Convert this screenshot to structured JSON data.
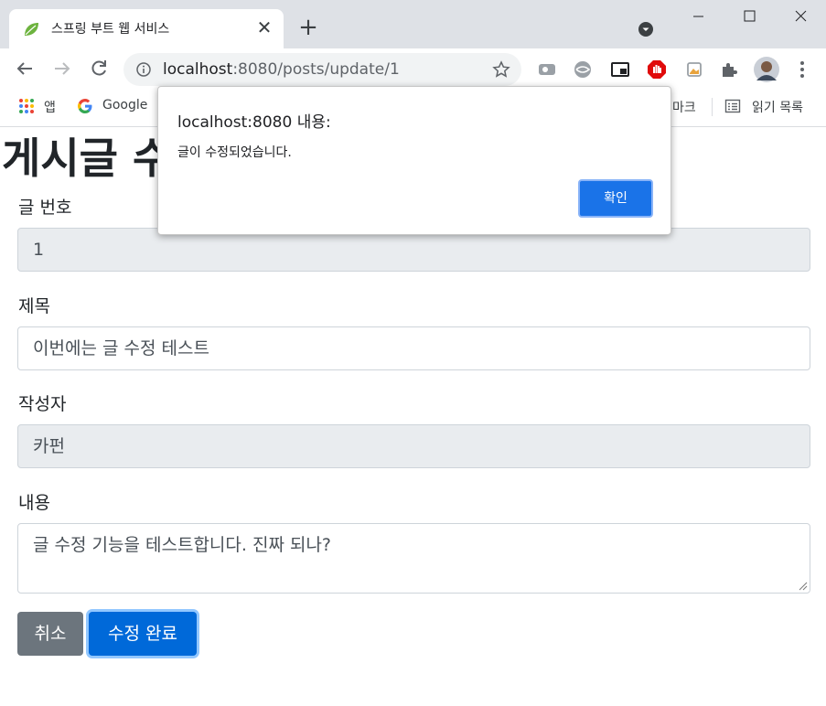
{
  "browser": {
    "tab_title": "스프링 부트 웹 서비스",
    "url_host": "localhost",
    "url_rest": ":8080/posts/update/1",
    "bookmarks": {
      "apps_label": "앱",
      "google_label": "Google",
      "bookmarks_label": "마크",
      "reading_list_label": "읽기 목록"
    }
  },
  "page": {
    "title": "게시글 수정",
    "fields": {
      "id_label": "글 번호",
      "id_value": "1",
      "title_label": "제목",
      "title_value": "이번에는 글 수정 테스트",
      "author_label": "작성자",
      "author_value": "카펀",
      "content_label": "내용",
      "content_value": "글 수정 기능을 테스트합니다. 진짜 되나?"
    },
    "buttons": {
      "cancel": "취소",
      "submit": "수정 완료"
    }
  },
  "dialog": {
    "title": "localhost:8080 내용:",
    "message": "글이 수정되었습니다.",
    "ok": "확인"
  },
  "colors": {
    "accent": "#1a73e8",
    "submit": "#0069d9",
    "cancel": "#6c757d",
    "readonly_bg": "#e9ecef"
  }
}
